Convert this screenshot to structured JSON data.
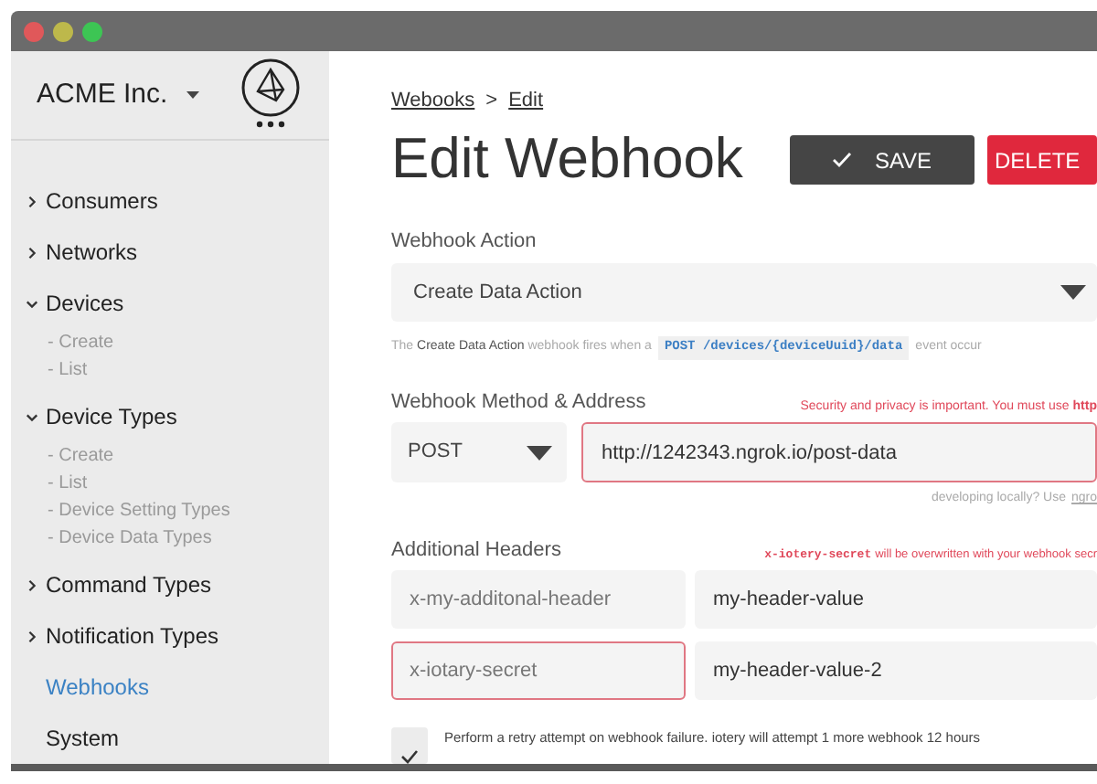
{
  "sidebar": {
    "org": "ACME Inc.",
    "nav": [
      {
        "label": "Consumers",
        "kind": "group",
        "expanded": false,
        "selected": false
      },
      {
        "label": "Networks",
        "kind": "group",
        "expanded": false,
        "selected": false
      },
      {
        "label": "Devices",
        "kind": "group",
        "expanded": true,
        "selected": false,
        "children": [
          "- Create",
          "- List"
        ]
      },
      {
        "label": "Device Types",
        "kind": "group",
        "expanded": true,
        "selected": false,
        "children": [
          "- Create",
          "- List",
          "- Device Setting Types",
          "- Device Data Types"
        ]
      },
      {
        "label": "Command Types",
        "kind": "group",
        "expanded": false,
        "selected": false
      },
      {
        "label": "Notification Types",
        "kind": "group",
        "expanded": false,
        "selected": false
      },
      {
        "label": "Webhooks",
        "kind": "link",
        "selected": true
      },
      {
        "label": "System",
        "kind": "link",
        "selected": false
      }
    ]
  },
  "breadcrumb": [
    "Webooks",
    "Edit"
  ],
  "breadcrumb_separator": ">",
  "title": "Edit Webhook",
  "buttons": [
    {
      "label": "SAVE",
      "kind": "save"
    },
    {
      "label": "DELETE",
      "kind": "delete"
    }
  ],
  "action": {
    "label": "Webhook Action",
    "value": "Create Data Action",
    "help": "The **Create Data Action** webhook fires when a",
    "help_code": "POST /devices/{deviceUuid}/data",
    "help_end": "event occur"
  },
  "method": {
    "label": "Webhook Method & Address",
    "method": "POST",
    "address": "http://1242343.ngrok.io/post-data",
    "invalid": true,
    "warning": "Security and privacy is important.  You must use **http**",
    "hint": "developing locally?  Use",
    "hint_link": "ngro"
  },
  "headers": {
    "label": "Additional Headers",
    "warning_code": "x-iotery-secret",
    "warning_text": "will be overwritten with your webhook secr",
    "rows": [
      {
        "key": "x-my-additonal-header",
        "value": "my-header-value",
        "invalid": false
      },
      {
        "key": "x-iotary-secret",
        "value": "my-header-value-2",
        "invalid": true
      }
    ]
  },
  "retry": {
    "checked": true,
    "text": "Perform a retry attempt on webhook failure.  iotery will attempt 1 more webhook 12 hours"
  }
}
